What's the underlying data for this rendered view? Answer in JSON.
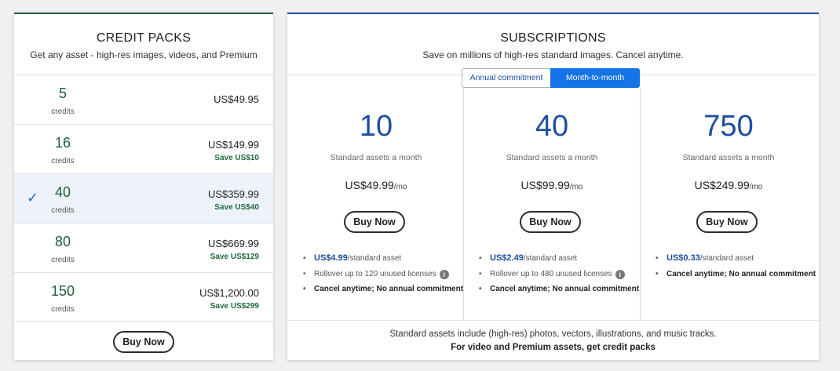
{
  "credit_packs": {
    "title": "CREDIT PACKS",
    "subtitle": "Get any asset - high-res images, videos, and Premium",
    "items": [
      {
        "credits": "5",
        "unit": "credits",
        "price": "US$49.95",
        "save": ""
      },
      {
        "credits": "16",
        "unit": "credits",
        "price": "US$149.99",
        "save": "Save US$10"
      },
      {
        "credits": "40",
        "unit": "credits",
        "price": "US$359.99",
        "save": "Save US$40",
        "selected": true,
        "check": "✓"
      },
      {
        "credits": "80",
        "unit": "credits",
        "price": "US$669.99",
        "save": "Save US$129"
      },
      {
        "credits": "150",
        "unit": "credits",
        "price": "US$1,200.00",
        "save": "Save US$299"
      }
    ],
    "buy_label": "Buy Now"
  },
  "subscriptions": {
    "title": "SUBSCRIPTIONS",
    "subtitle": "Save on millions of high-res standard images. Cancel anytime.",
    "toggle": {
      "annual": "Annual commitment",
      "monthly": "Month-to-month",
      "selected": "monthly"
    },
    "plans": [
      {
        "count": "10",
        "desc": "Standard assets a month",
        "price": "US$49.99",
        "per": "/mo",
        "buy_label": "Buy Now",
        "per_asset": "US$4.99",
        "per_asset_suffix": "/standard asset",
        "rollover": "Rollover up to 120 unused licenses",
        "cancel": "Cancel anytime; No annual commitment"
      },
      {
        "count": "40",
        "desc": "Standard assets a month",
        "price": "US$99.99",
        "per": "/mo",
        "buy_label": "Buy Now",
        "per_asset": "US$2.49",
        "per_asset_suffix": "/standard asset",
        "rollover": "Rollover up to 480 unused licenses",
        "cancel": "Cancel anytime; No annual commitment"
      },
      {
        "count": "750",
        "desc": "Standard assets a month",
        "price": "US$249.99",
        "per": "/mo",
        "buy_label": "Buy Now",
        "per_asset": "US$0.33",
        "per_asset_suffix": "/standard asset",
        "cancel": "Cancel anytime; No annual commitment"
      }
    ],
    "info_glyph": "i",
    "footer_line1": "Standard assets include (high-res) photos, vectors, illustrations, and music tracks.",
    "footer_line2": "For video and Premium assets, get credit packs"
  },
  "colors": {
    "credit_accent": "#1d5e3a",
    "subscription_accent": "#1d4ea0",
    "toggle_active": "#1473e6",
    "selected_row_bg": "#eef3fb"
  }
}
